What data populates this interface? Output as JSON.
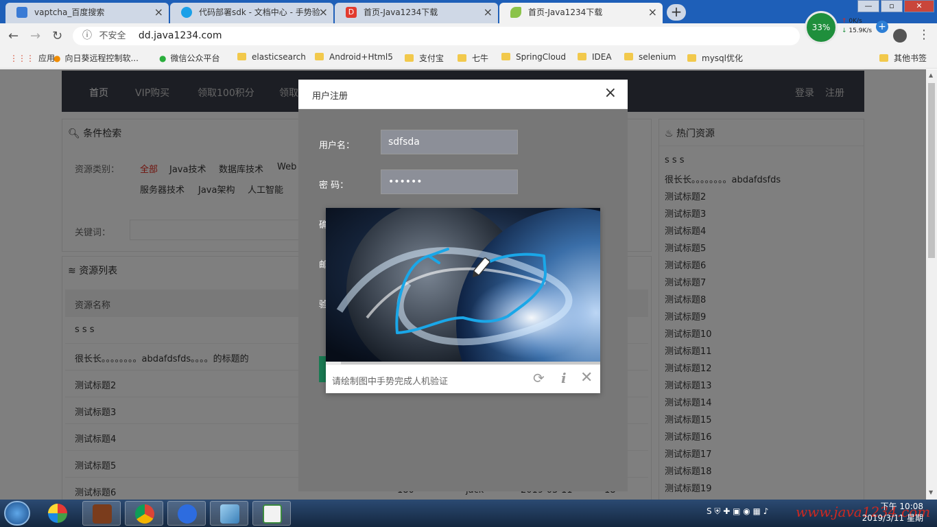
{
  "browser": {
    "tabs": [
      {
        "title": "vaptcha_百度搜索",
        "icon": "baidu-paw-icon",
        "color": "#3a7bd5"
      },
      {
        "title": "代码部署sdk - 文档中心 - 手势验",
        "icon": "vaptcha-shield-icon",
        "color": "#1aa0e8"
      },
      {
        "title": "首页-Java1234下载",
        "icon": "java1234-d-icon",
        "color": "#e23b2e"
      },
      {
        "title": "首页-Java1234下载",
        "icon": "leaf-icon",
        "color": "#8bc34a"
      }
    ],
    "insecure_label": "不安全",
    "url": "dd.java1234.com",
    "net_widget": {
      "percent": "33%",
      "upload": "0K/s",
      "download": "15.9K/s"
    },
    "bookmarks": [
      "应用",
      "向日葵远程控制软...",
      "微信公众平台",
      "elasticsearch",
      "Android+Html5",
      "支付宝",
      "七牛",
      "SpringCloud",
      "IDEA",
      "selenium",
      "mysql优化"
    ],
    "bookmarks_other": "其他书签"
  },
  "site": {
    "nav": [
      "首页",
      "VIP购买",
      "领取100积分",
      "领取"
    ],
    "login": "登录",
    "register": "注册",
    "filter_title": "条件检索",
    "category_label": "资源类别：",
    "categories_row1": [
      "全部",
      "Java技术",
      "数据库技术",
      "Web"
    ],
    "categories_row2": [
      "服务器技术",
      "Java架构",
      "人工智能"
    ],
    "keyword_label": "关键词：",
    "list_title": "资源列表",
    "col_name": "资源名称",
    "rows": [
      "s s s",
      "很长长。。。。。。。。abdafdsfds。。。。的标题的",
      "测试标题2",
      "测试标题3",
      "测试标题4",
      "测试标题5",
      "测试标题6"
    ],
    "last_row_tail": [
      "180",
      "jack",
      "2019-03-11",
      "18"
    ],
    "hot_title": "热门资源",
    "hot_items": [
      "s s s",
      "很长长。。。。。。。。abdafdsfds",
      "测试标题2",
      "测试标题3",
      "测试标题4",
      "测试标题5",
      "测试标题6",
      "测试标题7",
      "测试标题8",
      "测试标题9",
      "测试标题10",
      "测试标题11",
      "测试标题12",
      "测试标题13",
      "测试标题14",
      "测试标题15",
      "测试标题16",
      "测试标题17",
      "测试标题18",
      "测试标题19"
    ]
  },
  "modal": {
    "title": "用户注册",
    "close": "×",
    "username_label": "用户名：",
    "username_value": "sdfsda",
    "password_label": "密 码：",
    "password_value": "••••••",
    "hidden_labels": [
      "确",
      "邮",
      "验"
    ]
  },
  "captcha": {
    "hint": "请绘制图中手势完成人机验证",
    "refresh_icon": "refresh-icon",
    "info_icon": "info-icon",
    "close_icon": "close-icon"
  },
  "taskbar": {
    "time": "下午 10:08",
    "date": "2019/3/11 星期一",
    "watermark": "www.java1234.com"
  },
  "colors": {
    "nav_bg": "#393d49",
    "accent_red": "#e0271b",
    "gesture_blue": "#1aa7e8"
  }
}
